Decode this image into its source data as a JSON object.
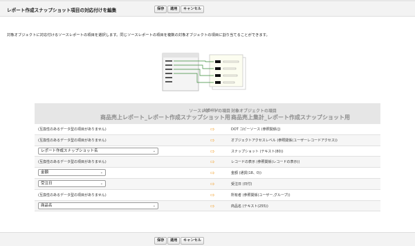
{
  "header": {
    "title": "レポート作成スナップショット項目の対応付けを編集",
    "buttons": {
      "save": "保存",
      "apply": "適用",
      "cancel": "キャンセル"
    }
  },
  "description": "対象オブジェクトに対応付けるソースレポートの項目を選択します。同じソースレポートの項目を複数の対象オブジェクトの項目に割り当てることができます。",
  "illustration": {
    "icon": "field-mapping-illustration-icon"
  },
  "table": {
    "source_header": "ソースレポートの項目",
    "source_title": "商品売上レポート_レポート作成スナップショット用",
    "mapping_header": "対応付け",
    "target_header": "対象オブジェクトの項目",
    "target_title": "商品売上集計_レポート作成スナップショット用",
    "rows": [
      {
        "type": "text",
        "source": "(互換性のあるデータ型の項目がありません)",
        "target": "DOT コピーソース (参照関係(])"
      },
      {
        "type": "text",
        "source": "(互換性のあるデータ型の項目がありません)",
        "target": "オブジェクトアクセスレベル (参照関係(ユーザーレコードアクセス))"
      },
      {
        "type": "select",
        "source": "レポート作成スナップショット名",
        "target": "スナップショット (テキスト(80))"
      },
      {
        "type": "text",
        "source": "(互換性のあるデータ型の項目がありません)",
        "target": "レコードの表示 (参照関係(レコードの表示))"
      },
      {
        "type": "select",
        "source": "金額",
        "target": "金額 (通貨(18、0))"
      },
      {
        "type": "select",
        "source": "受注日",
        "target": "受注日 (日付)"
      },
      {
        "type": "text",
        "source": "(互換性のあるデータ型の項目がありません)",
        "target": "所有者 (参照関係(ユーザー,グループ))"
      },
      {
        "type": "select",
        "source": "商品名",
        "target": "商品名 (テキスト(255))"
      }
    ]
  },
  "footer": {
    "buttons": {
      "save": "保存",
      "apply": "適用",
      "cancel": "キャンセル"
    }
  },
  "colors": {
    "arrow": "#f2a73b",
    "header_bg": "#e6e6e6",
    "bar_bg": "#f3f3f3"
  }
}
